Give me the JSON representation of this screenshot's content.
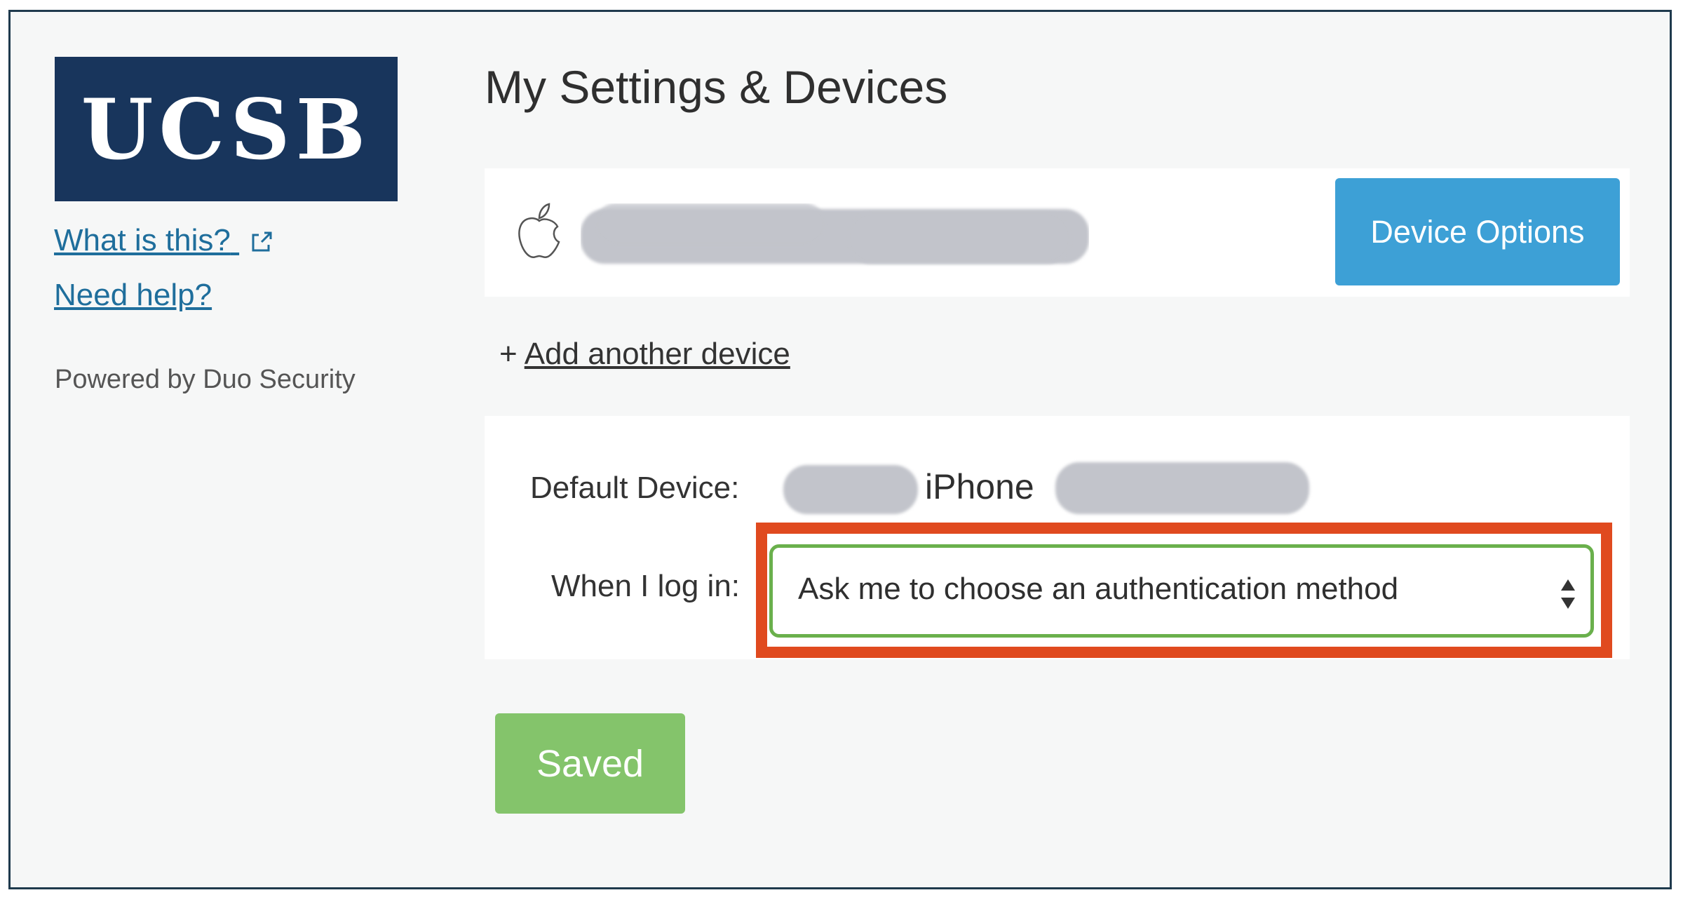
{
  "sidebar": {
    "logo_text": "UCSB",
    "what_is_this": "What is this?",
    "need_help": "Need help?",
    "powered_by": "Powered by Duo Security"
  },
  "main": {
    "title": "My Settings & Devices",
    "device": {
      "icon": "apple-icon",
      "name_redacted": true,
      "options_button": "Device Options"
    },
    "add_device": {
      "plus": "+",
      "label": "Add another device"
    },
    "default_device": {
      "label": "Default Device:",
      "value_visible": "iPhone"
    },
    "login": {
      "label": "When I log in:",
      "selected": "Ask me to choose an authentication method"
    },
    "saved_button": "Saved"
  },
  "colors": {
    "logo_bg": "#18355c",
    "device_options_bg": "#3da0d6",
    "saved_bg": "#84c46b",
    "highlight": "#e04a1f",
    "select_border": "#6ab04c",
    "link": "#1f6e9c"
  }
}
